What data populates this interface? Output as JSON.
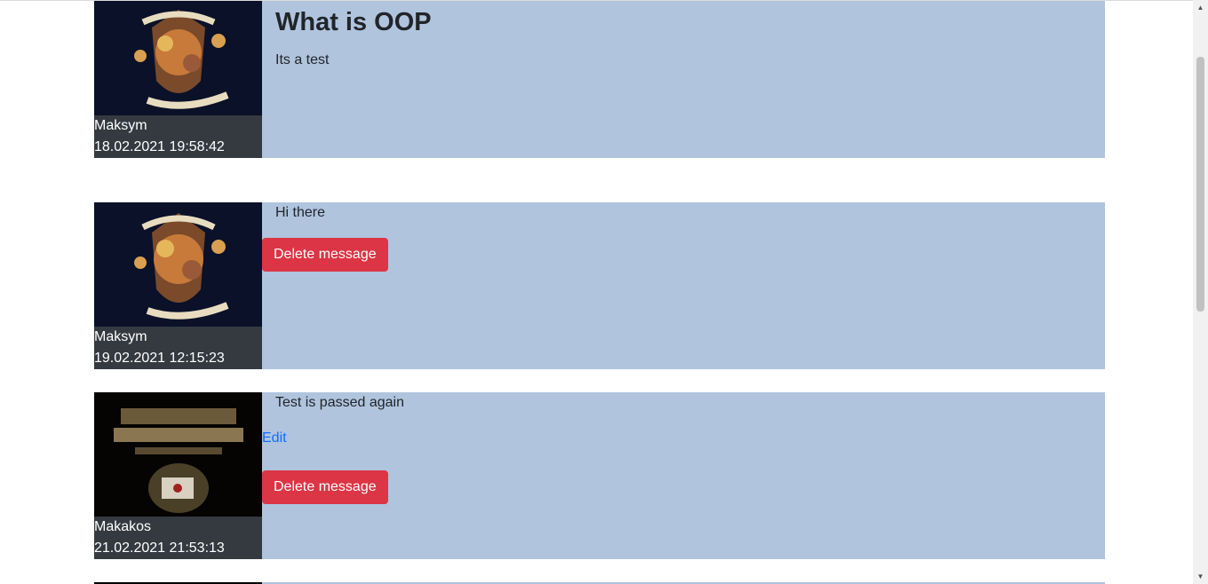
{
  "posts": [
    {
      "author": "Maksym",
      "date": "18.02.2021 19:58:42",
      "title": "What is OOP",
      "text": "Its a test",
      "avatar_icon": "crest-avatar"
    },
    {
      "author": "Maksym",
      "date": "19.02.2021 12:15:23",
      "text": "Hi there",
      "delete_label": "Delete message",
      "avatar_icon": "crest-avatar"
    },
    {
      "author": "Makakos",
      "date": "21.02.2021 21:53:13",
      "text": "Test is passed again",
      "edit_label": "Edit",
      "delete_label": "Delete message",
      "avatar_icon": "book-cover-avatar"
    }
  ],
  "colors": {
    "post_bg": "#b0c4de",
    "author_bg": "#343a40",
    "delete_button": "#dc3545",
    "link": "#0d6efd"
  }
}
